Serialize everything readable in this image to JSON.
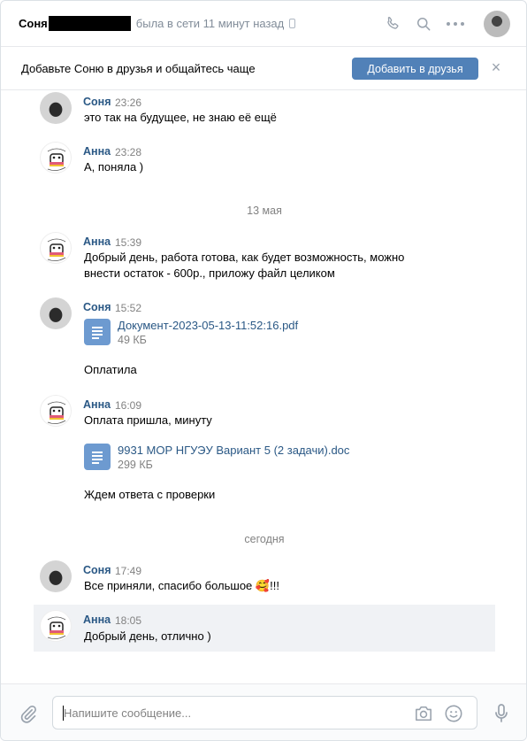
{
  "header": {
    "name": "Соня",
    "status": "была в сети 11 минут назад"
  },
  "banner": {
    "text": "Добавьте Соню в друзья и общайтесь чаще",
    "add_button": "Добавить в друзья",
    "close": "×"
  },
  "messages": [
    {
      "author": "Соня",
      "time": "23:26",
      "text": "это так на будущее, не знаю её ещё"
    },
    {
      "author": "Анна",
      "time": "23:28",
      "text": "А, поняла )"
    },
    {
      "date": "13 мая"
    },
    {
      "author": "Анна",
      "time": "15:39",
      "text": "Добрый день, работа готова, как будет возможность, можно внести остаток - 600р., приложу файл целиком"
    },
    {
      "author": "Соня",
      "time": "15:52",
      "doc_name": "Документ-2023-05-13-11:52:16.pdf",
      "doc_size": "49 КБ",
      "text": "Оплатила"
    },
    {
      "author": "Анна",
      "time": "16:09",
      "text": "Оплата пришла, минуту",
      "doc_name": "9931 МОР НГУЭУ Вариант 5 (2 задачи).doc",
      "doc_size": "299 КБ",
      "text2": "Ждем ответа с проверки"
    },
    {
      "date": "сегодня"
    },
    {
      "author": "Соня",
      "time": "17:49",
      "text": "Все приняли, спасибо большое",
      "emoji": "🥰",
      "suffix": "!!!"
    },
    {
      "author": "Анна",
      "time": "18:05",
      "text": "Добрый день, отлично )"
    }
  ],
  "composer": {
    "placeholder": "Напишите сообщение..."
  },
  "colors": {
    "accent": "#5181b8",
    "author_link": "#2a5885",
    "highlight_bg": "#f0f2f5"
  }
}
